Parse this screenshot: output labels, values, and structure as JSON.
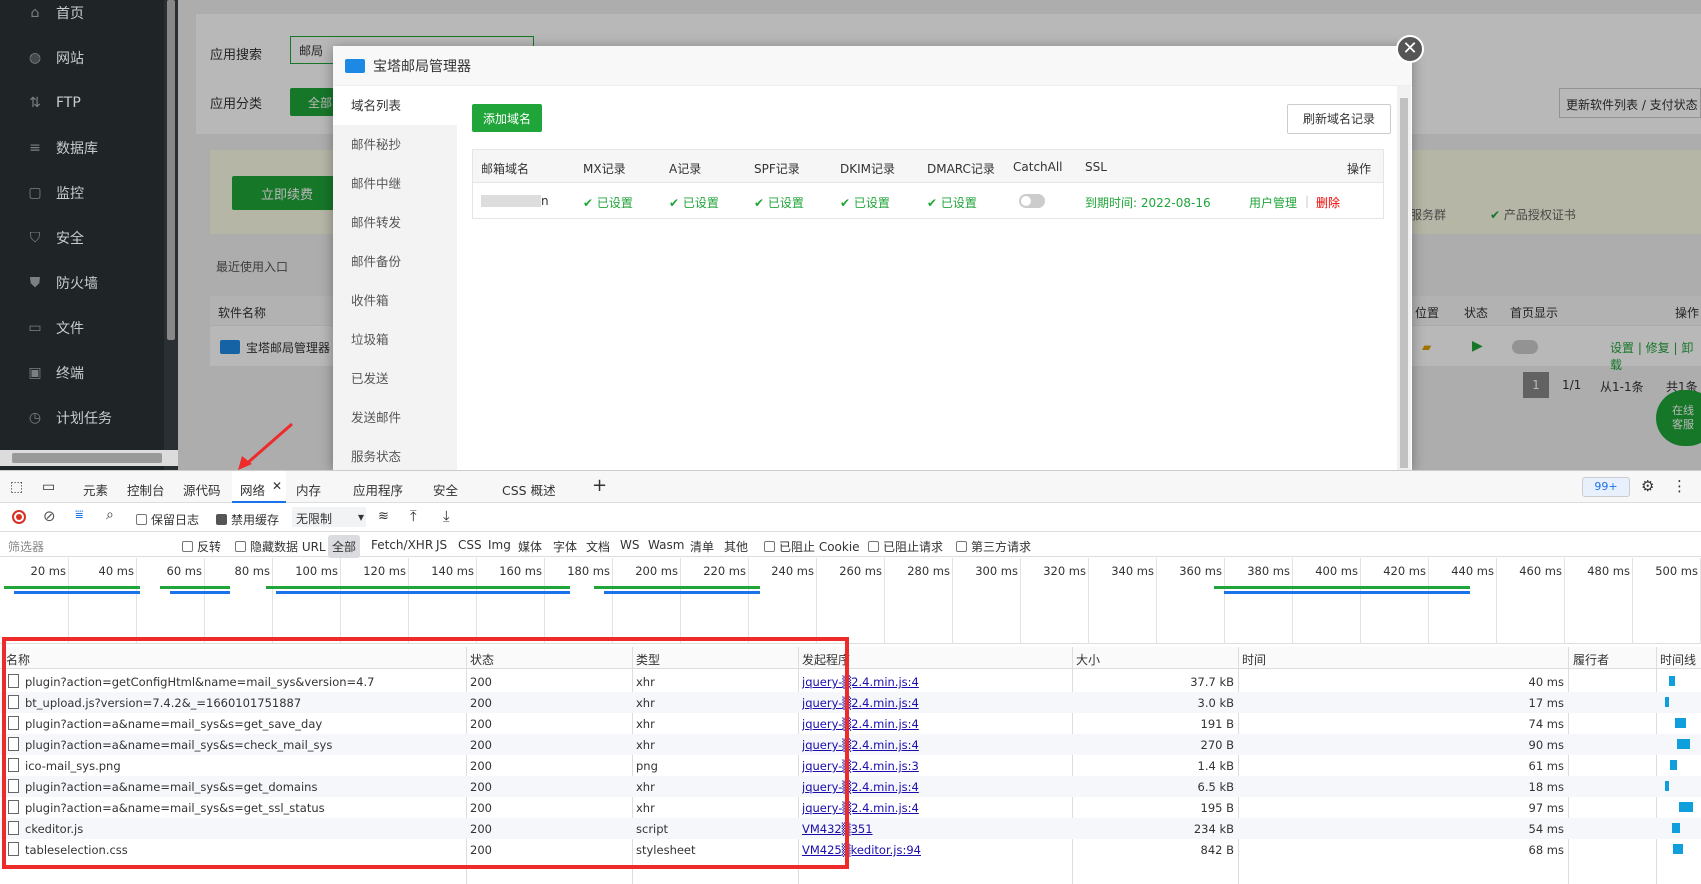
{
  "sidebar": {
    "items": [
      {
        "label": "首页",
        "icon": "home-icon"
      },
      {
        "label": "网站",
        "icon": "globe-icon"
      },
      {
        "label": "FTP",
        "icon": "ftp-icon"
      },
      {
        "label": "数据库",
        "icon": "database-icon"
      },
      {
        "label": "监控",
        "icon": "monitor-icon"
      },
      {
        "label": "安全",
        "icon": "shield-icon"
      },
      {
        "label": "防火墙",
        "icon": "firewall-icon"
      },
      {
        "label": "文件",
        "icon": "folder-icon"
      },
      {
        "label": "终端",
        "icon": "terminal-icon"
      },
      {
        "label": "计划任务",
        "icon": "clock-icon"
      }
    ]
  },
  "appstore": {
    "search_label": "应用搜索",
    "search_value": "邮局",
    "category_label": "应用分类",
    "category_all": "全部",
    "renew_button": "立即续费",
    "update_button": "更新软件列表 / 支付状态",
    "recent_label": "最近使用入口",
    "service_group": "服务群",
    "license_cert": "产品授权证书",
    "col_name": "软件名称",
    "col_position": "位置",
    "col_status": "状态",
    "col_homepage": "首页显示",
    "col_ops": "操作",
    "row_name": "宝塔邮局管理器",
    "row_actions": "设置 | 修复 | 卸载",
    "page_current": "1",
    "page_total": "1/1",
    "page_range": "从1-1条",
    "page_count": "共1条",
    "online_service": "在线\n客服"
  },
  "modal": {
    "title": "宝塔邮局管理器",
    "menu": [
      "域名列表",
      "邮件秘抄",
      "邮件中继",
      "邮件转发",
      "邮件备份",
      "收件箱",
      "垃圾箱",
      "已发送",
      "发送邮件",
      "服务状态"
    ],
    "add_domain": "添加域名",
    "refresh_domain": "刷新域名记录",
    "headers": [
      "邮箱域名",
      "MX记录",
      "A记录",
      "SPF记录",
      "DKIM记录",
      "DMARC记录",
      "CatchAll",
      "SSL",
      "操作"
    ],
    "row": {
      "domain": "n",
      "mx": "已设置",
      "a": "已设置",
      "spf": "已设置",
      "dkim": "已设置",
      "dmarc": "已设置",
      "ssl": "到期时间: 2022-08-16",
      "user_mgmt": "用户管理",
      "sep": "|",
      "delete": "删除"
    }
  },
  "devtools": {
    "tabs": [
      "元素",
      "控制台",
      "源代码",
      "网络",
      "内存",
      "应用程序",
      "安全",
      "CSS 概述"
    ],
    "badge": "99+",
    "preserve_log": "保留日志",
    "disable_cache": "禁用缓存",
    "throttle": "无限制",
    "filter_placeholder": "筛选器",
    "invert": "反转",
    "hide_data_url": "隐藏数据 URL",
    "types": [
      "全部",
      "Fetch/XHR",
      "JS",
      "CSS",
      "Img",
      "媒体",
      "字体",
      "文档",
      "WS",
      "Wasm",
      "清单",
      "其他"
    ],
    "blocked_cookie": "已阻止 Cookie",
    "blocked_req": "已阻止请求",
    "third_party": "第三方请求",
    "ticks": [
      "20 ms",
      "40 ms",
      "60 ms",
      "80 ms",
      "100 ms",
      "120 ms",
      "140 ms",
      "160 ms",
      "180 ms",
      "200 ms",
      "220 ms",
      "240 ms",
      "260 ms",
      "280 ms",
      "300 ms",
      "320 ms",
      "340 ms",
      "360 ms",
      "380 ms",
      "400 ms",
      "420 ms",
      "440 ms",
      "460 ms",
      "480 ms",
      "500 ms"
    ],
    "columns": [
      "名称",
      "状态",
      "类型",
      "发起程序",
      "大小",
      "时间",
      "履行者",
      "时间线"
    ],
    "rows": [
      {
        "name": "plugin?action=getConfigHtml&name=mail_sys&version=4.7",
        "status": "200",
        "type": "xhr",
        "initiator": "jquery-▒2.4.min.js:4",
        "size": "37.7 kB",
        "time": "40 ms",
        "wf": 0.05
      },
      {
        "name": "bt_upload.js?version=7.4.2&_=1660101751887",
        "status": "200",
        "type": "xhr",
        "initiator": "jquery-▒2.4.min.js:4",
        "size": "3.0 kB",
        "time": "17 ms",
        "wf": 0.02
      },
      {
        "name": "plugin?action=a&name=mail_sys&s=get_save_day",
        "status": "200",
        "type": "xhr",
        "initiator": "jquery-▒2.4.min.js:4",
        "size": "191 B",
        "time": "74 ms",
        "wf": 0.09
      },
      {
        "name": "plugin?action=a&name=mail_sys&s=check_mail_sys",
        "status": "200",
        "type": "xhr",
        "initiator": "jquery-▒2.4.min.js:4",
        "size": "270 B",
        "time": "90 ms",
        "wf": 0.11
      },
      {
        "name": "ico-mail_sys.png",
        "status": "200",
        "type": "png",
        "initiator": "jquery-▒2.4.min.js:3",
        "size": "1.4 kB",
        "time": "61 ms",
        "wf": 0.06
      },
      {
        "name": "plugin?action=a&name=mail_sys&s=get_domains",
        "status": "200",
        "type": "xhr",
        "initiator": "jquery-▒2.4.min.js:4",
        "size": "6.5 kB",
        "time": "18 ms",
        "wf": 0.02
      },
      {
        "name": "plugin?action=a&name=mail_sys&s=get_ssl_status",
        "status": "200",
        "type": "xhr",
        "initiator": "jquery-▒2.4.min.js:4",
        "size": "195 B",
        "time": "97 ms",
        "wf": 0.12
      },
      {
        "name": "ckeditor.js",
        "status": "200",
        "type": "script",
        "initiator": "VM432▒351",
        "size": "234 kB",
        "time": "54 ms",
        "wf": 0.07
      },
      {
        "name": "tableselection.css",
        "status": "200",
        "type": "stylesheet",
        "initiator": "VM425▒keditor.js:94",
        "size": "842 B",
        "time": "68 ms",
        "wf": 0.08
      }
    ]
  },
  "colors": {
    "accent": "#20a53a",
    "danger": "#ee2b2b",
    "sidebar": "#1f2427"
  }
}
